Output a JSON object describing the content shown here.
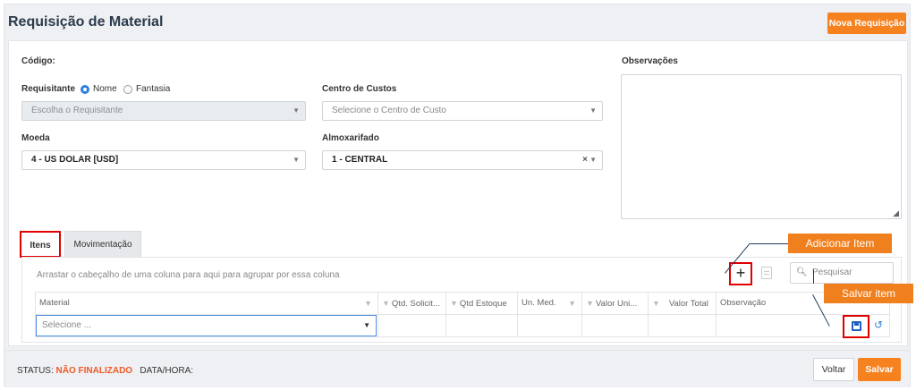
{
  "header": {
    "title": "Requisição de Material",
    "new_button": "Nova Requisição"
  },
  "form": {
    "codigo_label": "Código:",
    "requisitante_label": "Requisitante",
    "radio_nome": "Nome",
    "radio_fantasia": "Fantasia",
    "requisitante_placeholder": "Escolha o Requisitante",
    "centro_label": "Centro de Custos",
    "centro_placeholder": "Selecione o Centro de Custo",
    "moeda_label": "Moeda",
    "moeda_value": "4 - US DOLAR [USD]",
    "almox_label": "Almoxarifado",
    "almox_value": "1 - CENTRAL",
    "obs_label": "Observações"
  },
  "tabs": [
    {
      "label": "Itens",
      "active": true
    },
    {
      "label": "Movimentação",
      "active": false
    }
  ],
  "grid": {
    "group_hint": "Arrastar o cabeçalho de uma coluna para aqui para agrupar por essa coluna",
    "search_placeholder": "Pesquisar",
    "columns": [
      "Material",
      "Qtd. Solicit...",
      "Qtd Estoque",
      "Un. Med.",
      "Valor Uni...",
      "Valor Total",
      "Observação"
    ],
    "material_placeholder": "Selecione ..."
  },
  "callouts": {
    "add_item": "Adicionar Item",
    "save_item": "Salvar item"
  },
  "footer": {
    "status_label": "STATUS:",
    "status_value": "NÃO FINALIZADO",
    "datetime_label": "DATA/HORA:",
    "back_button": "Voltar",
    "save_button": "Salvar"
  },
  "colors": {
    "accent": "#f5821f",
    "highlight": "#e00000",
    "status": "#f05a28",
    "primary": "#2f7fe0"
  },
  "icons": [
    "chevron-down-icon",
    "close-icon",
    "plus-icon",
    "document-icon",
    "search-icon",
    "filter-icon",
    "save-icon",
    "undo-icon",
    "resize-icon"
  ]
}
